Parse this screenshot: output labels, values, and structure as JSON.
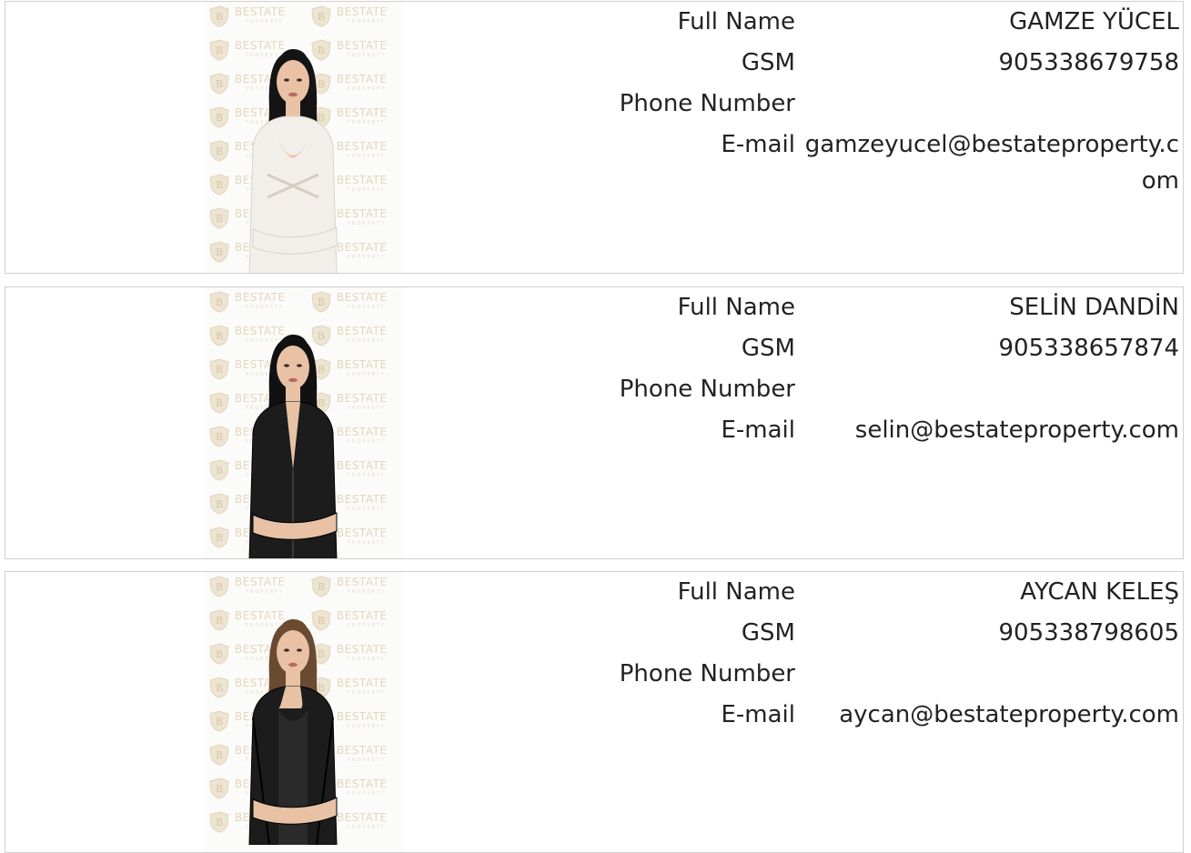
{
  "labels": {
    "full_name": "Full Name",
    "gsm": "GSM",
    "phone": "Phone Number",
    "email": "E-mail"
  },
  "watermark": {
    "brand": "BESTATE",
    "sub": "PROPERTY",
    "color": "#d3b98a"
  },
  "agents": [
    {
      "full_name": "GAMZE YÜCEL",
      "gsm": "905338679758",
      "phone": "",
      "email": "gamzeyucel@bestateproperty.com",
      "outfit": "white",
      "hair": "#141414"
    },
    {
      "full_name": "SELİN DANDİN",
      "gsm": "905338657874",
      "phone": "",
      "email": "selin@bestateproperty.com",
      "outfit": "black",
      "hair": "#111111"
    },
    {
      "full_name": "AYCAN KELEŞ",
      "gsm": "905338798605",
      "phone": "",
      "email": "aycan@bestateproperty.com",
      "outfit": "black-blazer",
      "hair": "#6b4a32"
    }
  ]
}
